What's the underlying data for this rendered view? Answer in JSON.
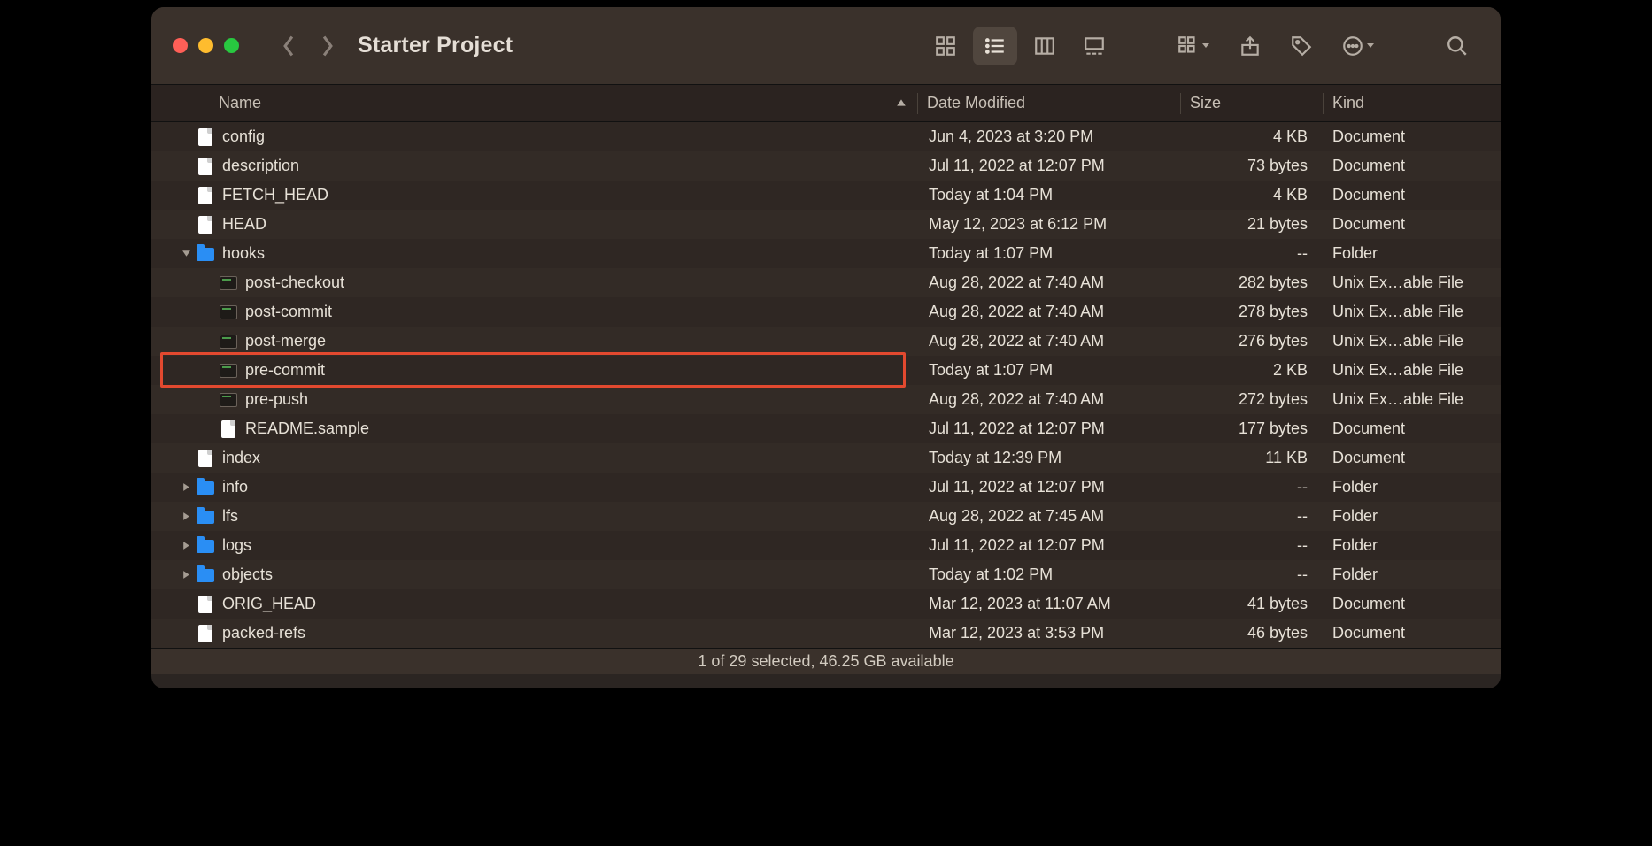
{
  "window": {
    "title": "Starter Project"
  },
  "columns": {
    "name": "Name",
    "date": "Date Modified",
    "size": "Size",
    "kind": "Kind"
  },
  "status": "1 of 29 selected, 46.25 GB available",
  "rows": [
    {
      "indent": 0,
      "disclose": "",
      "icon": "doc",
      "name": "config",
      "date": "Jun 4, 2023 at 3:20 PM",
      "size": "4 KB",
      "kind": "Document",
      "hl": false
    },
    {
      "indent": 0,
      "disclose": "",
      "icon": "doc",
      "name": "description",
      "date": "Jul 11, 2022 at 12:07 PM",
      "size": "73 bytes",
      "kind": "Document",
      "hl": false
    },
    {
      "indent": 0,
      "disclose": "",
      "icon": "doc",
      "name": "FETCH_HEAD",
      "date": "Today at 1:04 PM",
      "size": "4 KB",
      "kind": "Document",
      "hl": false
    },
    {
      "indent": 0,
      "disclose": "",
      "icon": "doc",
      "name": "HEAD",
      "date": "May 12, 2023 at 6:12 PM",
      "size": "21 bytes",
      "kind": "Document",
      "hl": false
    },
    {
      "indent": 0,
      "disclose": "down",
      "icon": "fld",
      "name": "hooks",
      "date": "Today at 1:07 PM",
      "size": "--",
      "kind": "Folder",
      "hl": false
    },
    {
      "indent": 1,
      "disclose": "",
      "icon": "exe",
      "name": "post-checkout",
      "date": "Aug 28, 2022 at 7:40 AM",
      "size": "282 bytes",
      "kind": "Unix Ex…able File",
      "hl": false
    },
    {
      "indent": 1,
      "disclose": "",
      "icon": "exe",
      "name": "post-commit",
      "date": "Aug 28, 2022 at 7:40 AM",
      "size": "278 bytes",
      "kind": "Unix Ex…able File",
      "hl": false
    },
    {
      "indent": 1,
      "disclose": "",
      "icon": "exe",
      "name": "post-merge",
      "date": "Aug 28, 2022 at 7:40 AM",
      "size": "276 bytes",
      "kind": "Unix Ex…able File",
      "hl": false
    },
    {
      "indent": 1,
      "disclose": "",
      "icon": "exe",
      "name": "pre-commit",
      "date": "Today at 1:07 PM",
      "size": "2 KB",
      "kind": "Unix Ex…able File",
      "hl": true
    },
    {
      "indent": 1,
      "disclose": "",
      "icon": "exe",
      "name": "pre-push",
      "date": "Aug 28, 2022 at 7:40 AM",
      "size": "272 bytes",
      "kind": "Unix Ex…able File",
      "hl": false
    },
    {
      "indent": 1,
      "disclose": "",
      "icon": "doc",
      "name": "README.sample",
      "date": "Jul 11, 2022 at 12:07 PM",
      "size": "177 bytes",
      "kind": "Document",
      "hl": false
    },
    {
      "indent": 0,
      "disclose": "",
      "icon": "doc",
      "name": "index",
      "date": "Today at 12:39 PM",
      "size": "11 KB",
      "kind": "Document",
      "hl": false
    },
    {
      "indent": 0,
      "disclose": "right",
      "icon": "fld",
      "name": "info",
      "date": "Jul 11, 2022 at 12:07 PM",
      "size": "--",
      "kind": "Folder",
      "hl": false
    },
    {
      "indent": 0,
      "disclose": "right",
      "icon": "fld",
      "name": "lfs",
      "date": "Aug 28, 2022 at 7:45 AM",
      "size": "--",
      "kind": "Folder",
      "hl": false
    },
    {
      "indent": 0,
      "disclose": "right",
      "icon": "fld",
      "name": "logs",
      "date": "Jul 11, 2022 at 12:07 PM",
      "size": "--",
      "kind": "Folder",
      "hl": false
    },
    {
      "indent": 0,
      "disclose": "right",
      "icon": "fld",
      "name": "objects",
      "date": "Today at 1:02 PM",
      "size": "--",
      "kind": "Folder",
      "hl": false
    },
    {
      "indent": 0,
      "disclose": "",
      "icon": "doc",
      "name": "ORIG_HEAD",
      "date": "Mar 12, 2023 at 11:07 AM",
      "size": "41 bytes",
      "kind": "Document",
      "hl": false
    },
    {
      "indent": 0,
      "disclose": "",
      "icon": "doc",
      "name": "packed-refs",
      "date": "Mar 12, 2023 at 3:53 PM",
      "size": "46 bytes",
      "kind": "Document",
      "hl": false
    }
  ]
}
